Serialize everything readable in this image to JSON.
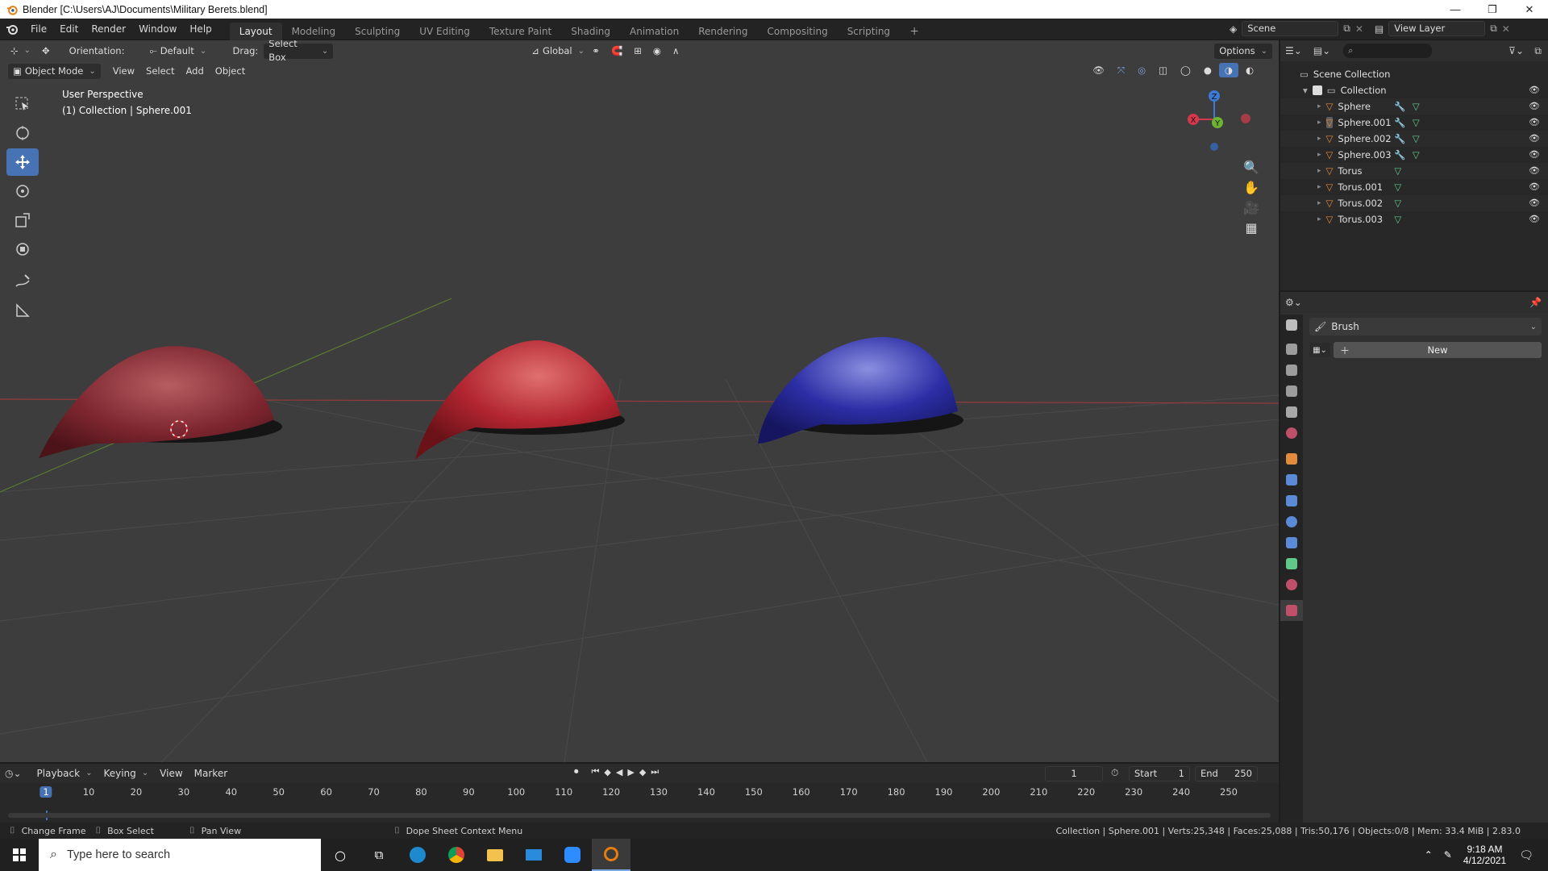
{
  "window": {
    "title": "Blender [C:\\Users\\AJ\\Documents\\Military Berets.blend]"
  },
  "menu": [
    "File",
    "Edit",
    "Render",
    "Window",
    "Help"
  ],
  "workspaces": [
    {
      "label": "Layout",
      "active": true
    },
    {
      "label": "Modeling"
    },
    {
      "label": "Sculpting"
    },
    {
      "label": "UV Editing"
    },
    {
      "label": "Texture Paint"
    },
    {
      "label": "Shading"
    },
    {
      "label": "Animation"
    },
    {
      "label": "Rendering"
    },
    {
      "label": "Compositing"
    },
    {
      "label": "Scripting"
    }
  ],
  "scene": {
    "name": "Scene",
    "view_layer": "View Layer"
  },
  "tool_settings": {
    "orientation_label": "Orientation:",
    "orientation_value": "Default",
    "drag_label": "Drag:",
    "drag_value": "Select Box",
    "transform_orientation": "Global",
    "options_label": "Options"
  },
  "viewport_header": {
    "mode": "Object Mode",
    "view": "View",
    "select": "Select",
    "add": "Add",
    "object": "Object"
  },
  "viewport_overlay": {
    "perspective": "User Perspective",
    "collection_info": "(1) Collection | Sphere.001"
  },
  "gizmo": {
    "z": "Z",
    "y": "Y",
    "x": "X"
  },
  "outliner": {
    "root": "Scene Collection",
    "collection": "Collection",
    "items": [
      {
        "name": "Sphere",
        "modifier": true
      },
      {
        "name": "Sphere.001",
        "modifier": true,
        "selected": true
      },
      {
        "name": "Sphere.002",
        "modifier": true
      },
      {
        "name": "Sphere.003",
        "modifier": true
      },
      {
        "name": "Torus",
        "modifier": false
      },
      {
        "name": "Torus.001",
        "modifier": false
      },
      {
        "name": "Torus.002",
        "modifier": false
      },
      {
        "name": "Torus.003",
        "modifier": false
      }
    ]
  },
  "properties": {
    "brush_label": "Brush",
    "new_button": "New"
  },
  "timeline": {
    "playback": "Playback",
    "keying": "Keying",
    "view": "View",
    "marker": "Marker",
    "current_frame": "1",
    "start_label": "Start",
    "start_value": "1",
    "end_label": "End",
    "end_value": "250",
    "ticks": [
      "1",
      "10",
      "20",
      "30",
      "40",
      "50",
      "60",
      "70",
      "80",
      "90",
      "100",
      "110",
      "120",
      "130",
      "140",
      "150",
      "160",
      "170",
      "180",
      "190",
      "200",
      "210",
      "220",
      "230",
      "240",
      "250"
    ]
  },
  "statusbar": {
    "change_frame": "Change Frame",
    "box_select": "Box Select",
    "pan_view": "Pan View",
    "context_menu": "Dope Sheet Context Menu",
    "stats": "Collection | Sphere.001 | Verts:25,348 | Faces:25,088 | Tris:50,176 | Objects:0/8 | Mem: 33.4 MiB | 2.83.0"
  },
  "taskbar": {
    "search_placeholder": "Type here to search",
    "time": "9:18 AM",
    "date": "4/12/2021"
  },
  "colors": {
    "accent": "#4772b3",
    "object_orange": "#e38b3c",
    "mesh_green": "#5fc98a"
  }
}
